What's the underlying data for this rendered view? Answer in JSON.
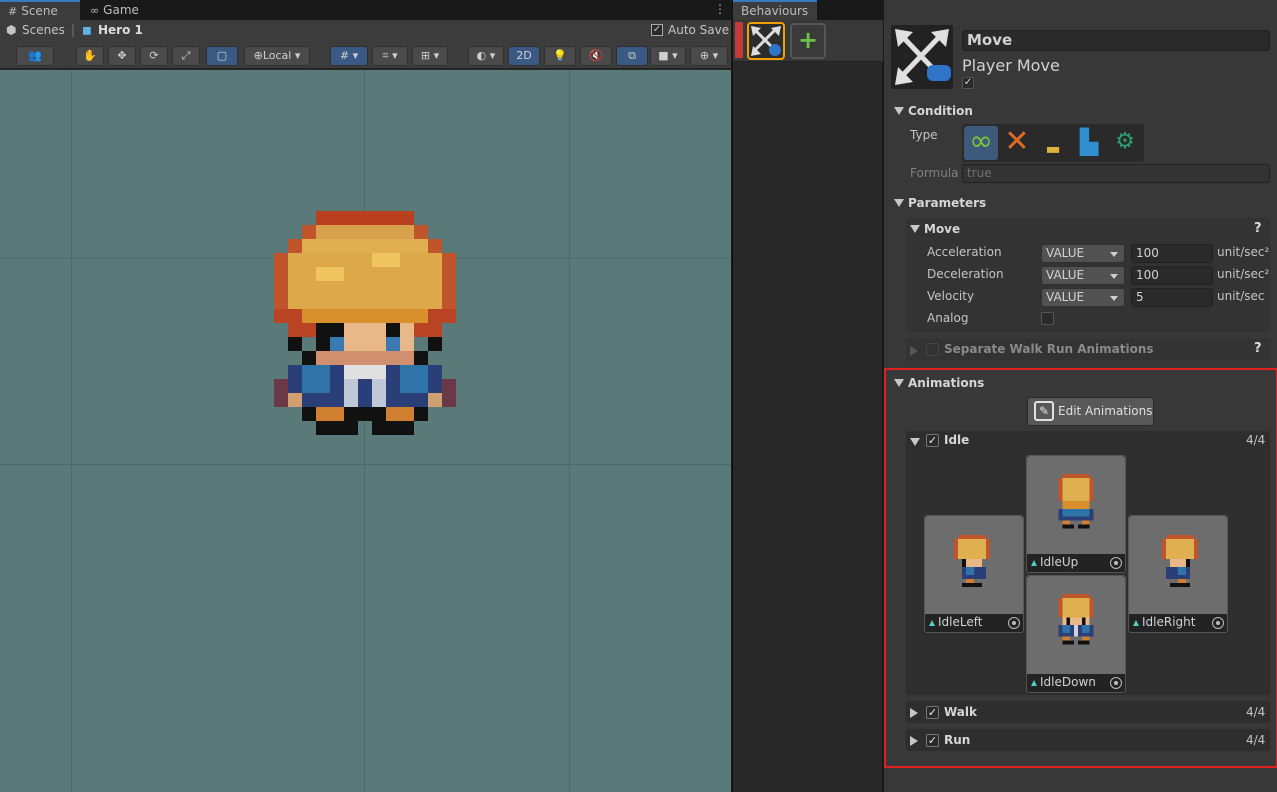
{
  "scene_tabs": {
    "scene": "Scene",
    "game": "Game"
  },
  "breadcrumb": {
    "root": "Scenes",
    "object": "Hero 1"
  },
  "autosave": {
    "label": "Auto Save",
    "checked": true
  },
  "toolbar": {
    "pivot_mode": "Local",
    "mode_2d": "2D"
  },
  "behaviours": {
    "tab": "Behaviours"
  },
  "inspector": {
    "title": "Move",
    "subtitle": "Player Move",
    "condition": {
      "header": "Condition",
      "type_label": "Type",
      "formula_label": "Formula",
      "formula_placeholder": "true"
    },
    "parameters": {
      "header": "Parameters",
      "move": {
        "header": "Move",
        "help": "?",
        "rows": [
          {
            "label": "Acceleration",
            "mode": "VALUE",
            "value": "100",
            "unit": "unit/sec²"
          },
          {
            "label": "Deceleration",
            "mode": "VALUE",
            "value": "100",
            "unit": "unit/sec²"
          },
          {
            "label": "Velocity",
            "mode": "VALUE",
            "value": "5",
            "unit": "unit/sec"
          }
        ],
        "analog_label": "Analog"
      },
      "separate": {
        "label": "Separate Walk Run Animations",
        "help": "?"
      }
    },
    "animations": {
      "header": "Animations",
      "edit_button": "Edit Animations",
      "idle": {
        "label": "Idle",
        "count": "4/4",
        "clips": {
          "up": "IdleUp",
          "left": "IdleLeft",
          "right": "IdleRight",
          "down": "IdleDown"
        }
      },
      "walk": {
        "label": "Walk",
        "count": "4/4"
      },
      "run": {
        "label": "Run",
        "count": "4/4"
      }
    }
  },
  "colors": {
    "highlight_border": "#e02020",
    "selection_border": "#f0a000",
    "add_icon": "#6cc04a"
  }
}
